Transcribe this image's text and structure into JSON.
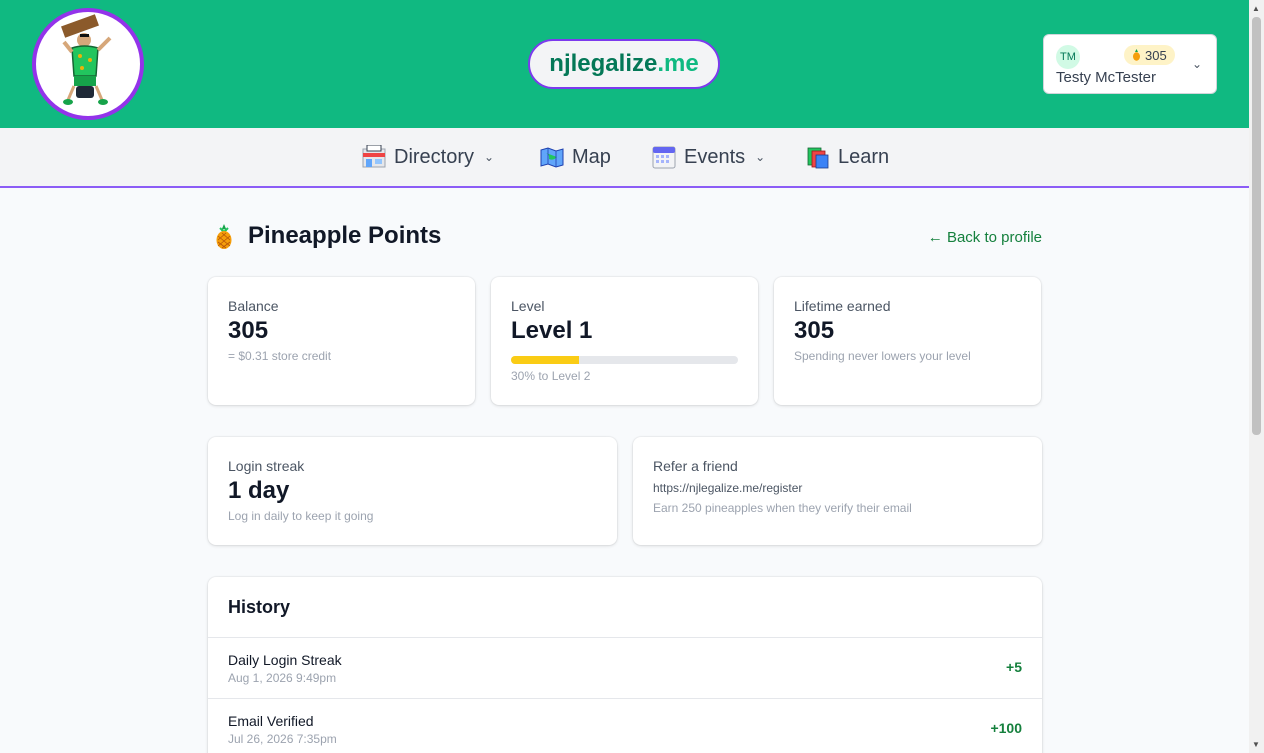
{
  "header": {
    "site_name": "njlegalize",
    "site_tld": ".me",
    "user": {
      "initials": "TM",
      "name": "Testy McTester",
      "points": "305"
    }
  },
  "nav": [
    {
      "label": "Directory",
      "icon": "store-icon",
      "dropdown": true
    },
    {
      "label": "Map",
      "icon": "map-icon",
      "dropdown": false
    },
    {
      "label": "Events",
      "icon": "calendar-icon",
      "dropdown": true
    },
    {
      "label": "Learn",
      "icon": "books-icon",
      "dropdown": false
    }
  ],
  "page": {
    "title": "Pineapple Points",
    "back_link": "← Back to profile"
  },
  "stats": {
    "balance": {
      "label": "Balance",
      "value": "305",
      "sub": "= $0.31 store credit"
    },
    "level": {
      "label": "Level",
      "value": "Level 1",
      "progress_percent": 30,
      "sub": "30% to Level 2"
    },
    "lifetime": {
      "label": "Lifetime earned",
      "value": "305",
      "sub": "Spending never lowers your level"
    },
    "streak": {
      "label": "Login streak",
      "value": "1 day",
      "sub": "Log in daily to keep it going"
    },
    "refer": {
      "label": "Refer a friend",
      "url": "https://njlegalize.me/register",
      "sub": "Earn 250 pineapples when they verify their email"
    }
  },
  "history": {
    "title": "History",
    "rows": [
      {
        "name": "Daily Login Streak",
        "date": "Aug 1, 2026 9:49pm",
        "amount": "+5"
      },
      {
        "name": "Email Verified",
        "date": "Jul 26, 2026 7:35pm",
        "amount": "+100"
      }
    ]
  },
  "colors": {
    "header_bg": "#10b981",
    "accent_purple": "#8b5cf6",
    "link_green": "#15803d",
    "progress_yellow": "#facc15"
  }
}
